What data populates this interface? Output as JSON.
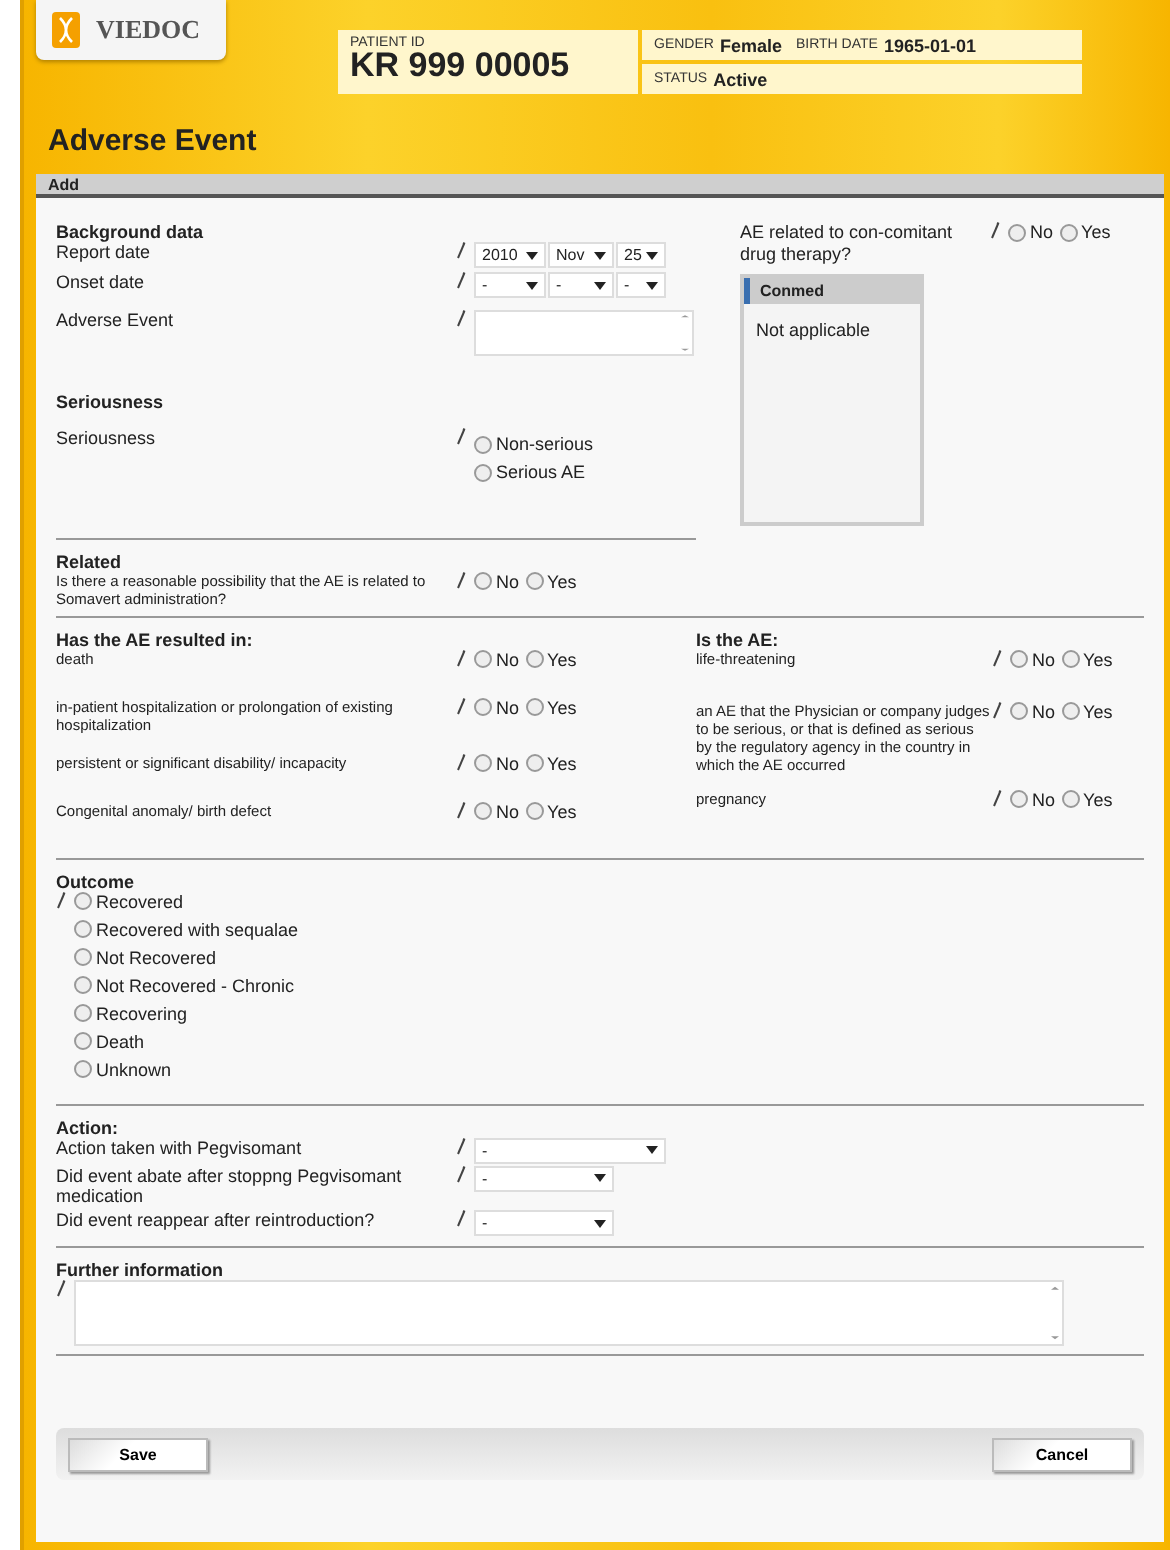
{
  "header": {
    "logo": "VIEDOC",
    "patient_id_label": "PATIENT ID",
    "patient_id": "KR 999 00005",
    "gender_label": "GENDER",
    "gender": "Female",
    "birth_label": "BIRTH DATE",
    "birth_date": "1965-01-01",
    "status_label": "STATUS",
    "status": "Active"
  },
  "page_title": "Adverse Event",
  "panel_title": "Add",
  "background": {
    "heading": "Background data",
    "report_date": {
      "label": "Report date",
      "selects": [
        "2010",
        "Nov",
        "25"
      ]
    },
    "onset_date": {
      "label": "Onset date",
      "selects": [
        "-",
        "-",
        "-"
      ]
    },
    "adverse_event": {
      "label": "Adverse Event"
    }
  },
  "conmed_question": {
    "label": "AE related to con-comitant drug therapy?",
    "options": [
      {
        "label": "No",
        "selected": false
      },
      {
        "label": "Yes",
        "selected": false
      }
    ]
  },
  "conmed_box": {
    "title": "Conmed",
    "text": "Not applicable"
  },
  "seriousness": {
    "heading": "Seriousness",
    "label": "Seriousness",
    "options": [
      {
        "label": "Non-serious",
        "selected": false
      },
      {
        "label": "Serious AE",
        "selected": false
      }
    ]
  },
  "related": {
    "heading": "Related",
    "label": "Is there a reasonable possibility that the AE is related to Somavert administration?",
    "options": [
      {
        "label": "No",
        "selected": false
      },
      {
        "label": "Yes",
        "selected": false
      }
    ]
  },
  "resulted": {
    "heading": "Has the AE resulted in:",
    "items": [
      {
        "label": "death",
        "options": [
          {
            "label": "No",
            "selected": false
          },
          {
            "label": "Yes",
            "selected": false
          }
        ]
      },
      {
        "label": "in-patient hospitalization or prolongation of existing hospitalization",
        "options": [
          {
            "label": "No",
            "selected": false
          },
          {
            "label": "Yes",
            "selected": false
          }
        ]
      },
      {
        "label": "persistent or significant disability/ incapacity",
        "options": [
          {
            "label": "No",
            "selected": false
          },
          {
            "label": "Yes",
            "selected": false
          }
        ]
      },
      {
        "label": "Congenital anomaly/ birth defect",
        "options": [
          {
            "label": "No",
            "selected": false
          },
          {
            "label": "Yes",
            "selected": false
          }
        ]
      }
    ]
  },
  "is_ae": {
    "heading": "Is the AE:",
    "items": [
      {
        "label": "life-threatening",
        "options": [
          {
            "label": "No",
            "selected": false
          },
          {
            "label": "Yes",
            "selected": false
          }
        ]
      },
      {
        "label": "an AE that the Physician or company judges to be serious, or that is defined as serious by the regulatory agency in the country in which the AE occurred",
        "options": [
          {
            "label": "No",
            "selected": false
          },
          {
            "label": "Yes",
            "selected": false
          }
        ]
      },
      {
        "label": "pregnancy",
        "options": [
          {
            "label": "No",
            "selected": false
          },
          {
            "label": "Yes",
            "selected": false
          }
        ]
      }
    ]
  },
  "outcome": {
    "heading": "Outcome",
    "options": [
      {
        "label": "Recovered",
        "selected": false
      },
      {
        "label": "Recovered with sequalae",
        "selected": false
      },
      {
        "label": "Not Recovered",
        "selected": false
      },
      {
        "label": "Not Recovered - Chronic",
        "selected": false
      },
      {
        "label": "Recovering",
        "selected": false
      },
      {
        "label": "Death",
        "selected": false
      },
      {
        "label": "Unknown",
        "selected": false
      }
    ]
  },
  "action": {
    "heading": "Action:",
    "items": [
      {
        "label": "Action taken with Pegvisomant",
        "value": "-",
        "kind": "wide"
      },
      {
        "label": "Did event abate after stoppng Pegvisomant medication",
        "value": "-",
        "kind": "narrow"
      },
      {
        "label": "Did event reappear after reintroduction?",
        "value": "-",
        "kind": "narrow"
      }
    ]
  },
  "further": {
    "heading": "Further information"
  },
  "buttons": [
    "Save",
    "Cancel"
  ]
}
